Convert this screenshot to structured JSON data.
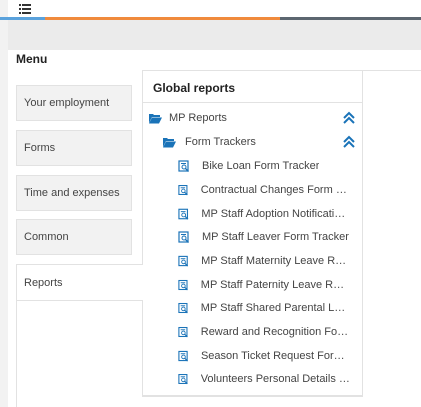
{
  "menu": {
    "title": "Menu",
    "items": [
      {
        "label": "Your employment"
      },
      {
        "label": "Forms"
      },
      {
        "label": "Time and expenses"
      },
      {
        "label": "Common"
      },
      {
        "label": "Reports"
      }
    ],
    "active": "Reports"
  },
  "reports": {
    "title": "Global reports",
    "root_folder": "MP Reports",
    "sub_folder": "Form Trackers",
    "items": [
      {
        "label": "Bike Loan Form Tracker"
      },
      {
        "label": "Contractual Changes Form (MP ..."
      },
      {
        "label": "MP Staff Adoption Notification ..."
      },
      {
        "label": "MP Staff Leaver Form Tracker"
      },
      {
        "label": "MP Staff Maternity Leave Requ..."
      },
      {
        "label": "MP Staff Paternity Leave Reque..."
      },
      {
        "label": "MP Staff Shared Parental Leave..."
      },
      {
        "label": "Reward and Recognition Form T..."
      },
      {
        "label": "Season Ticket Request Form Tr..."
      },
      {
        "label": "Volunteers Personal Details Cha..."
      }
    ]
  },
  "colors": {
    "accent_blue": "#5aa2dc",
    "accent_orange": "#f08a3c",
    "accent_gray": "#5c6670",
    "icon_blue": "#1a73b8"
  },
  "icons": {
    "hamburger": "menu-icon",
    "folder": "folder-open-icon",
    "report": "report-icon",
    "collapse": "double-chevron-up-icon"
  }
}
